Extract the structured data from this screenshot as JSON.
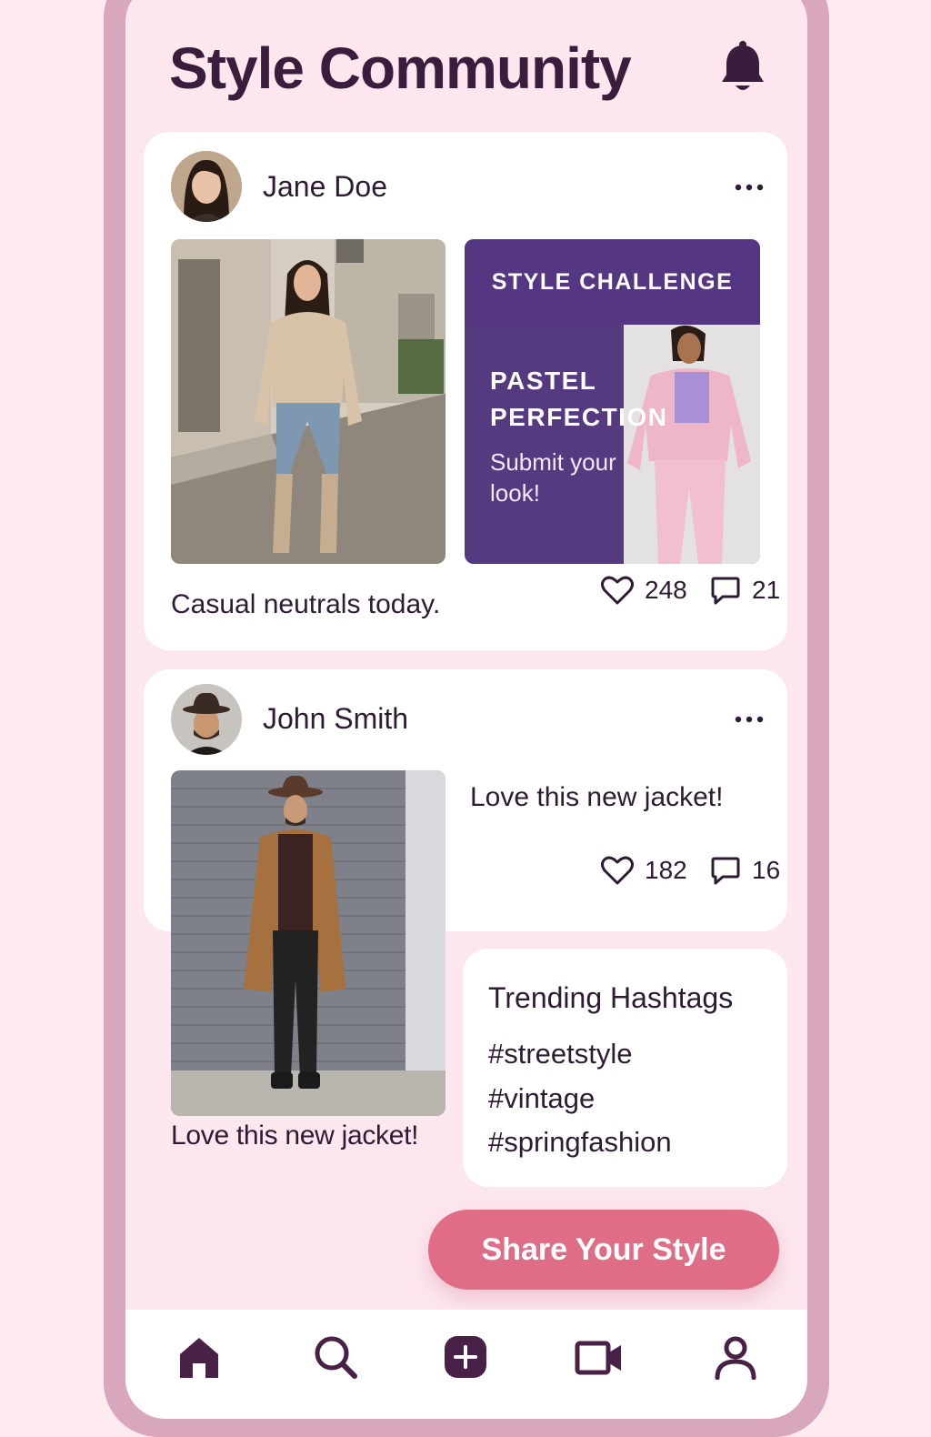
{
  "header": {
    "title": "Style Community",
    "bell_icon": "bell-icon"
  },
  "posts": [
    {
      "user": "Jane Doe",
      "caption": "Casual neutrals today.",
      "likes": "248",
      "comments": "21"
    },
    {
      "user": "John Smith",
      "caption": "Love this new jacket!",
      "bottom_caption": "Love this new jacket!",
      "likes": "182",
      "comments": "16"
    }
  ],
  "challenge": {
    "header": "STYLE CHALLENGE",
    "title_line1": "PASTEL",
    "title_line2": "PERFECTION",
    "subtitle": "Submit your look!"
  },
  "trending": {
    "title": "Trending Hashtags",
    "tags": [
      "#streetstyle",
      "#vintage",
      "#springfashion"
    ]
  },
  "cta": {
    "label": "Share Your Style"
  },
  "nav": {
    "items": [
      "home-icon",
      "search-icon",
      "add-icon",
      "video-icon",
      "profile-icon"
    ],
    "accent": "#4a2146"
  },
  "colors": {
    "background": "#fde7ef",
    "accent_purple": "#553682",
    "cta_pink": "#de6d85",
    "text_dark": "#2e1a33"
  }
}
